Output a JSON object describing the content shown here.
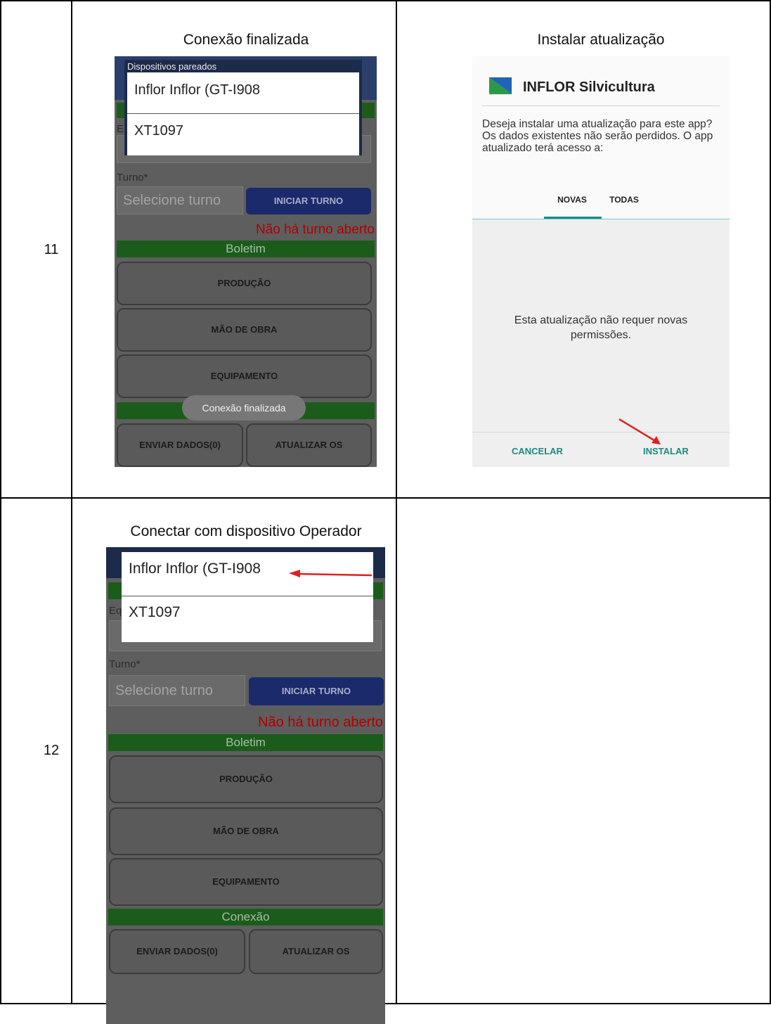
{
  "rows": [
    {
      "number": "11"
    },
    {
      "number": "12"
    }
  ],
  "panel_11_left": {
    "caption": "Conexão finalizada",
    "popup_title": "Dispositivos pareados",
    "devices": [
      "Inflor Inflor (GT-I908",
      "XT1097"
    ],
    "turno_label": "Turno*",
    "turno_placeholder": "Selecione turno",
    "iniciar_turno": "INICIAR TURNO",
    "no_shift": "Não há turno aberto",
    "boletim": "Boletim",
    "producao": "PRODUÇÃO",
    "mao_de_obra": "MÃO DE OBRA",
    "equipamento": "EQUIPAMENTO",
    "toast": "Conexão finalizada",
    "enviar_dados": "ENVIAR DADOS(0)",
    "atualizar_os": "ATUALIZAR OS"
  },
  "panel_11_right": {
    "caption": "Instalar atualização",
    "app_name": "INFLOR Silvicultura",
    "question": "Deseja instalar uma atualização para este app? Os dados existentes não serão perdidos. O app atualizado terá acesso a:",
    "tab_novas": "NOVAS",
    "tab_todas": "TODAS",
    "no_permissions": "Esta atualização não requer novas permissões.",
    "cancelar": "CANCELAR",
    "instalar": "INSTALAR"
  },
  "panel_12_left": {
    "caption": "Conectar com dispositivo Operador",
    "devices": [
      "Inflor Inflor (GT-I908",
      "XT1097"
    ],
    "turno_label": "Turno*",
    "turno_placeholder": "Selecione turno",
    "iniciar_turno": "INICIAR TURNO",
    "no_shift": "Não há turno aberto",
    "boletim": "Boletim",
    "producao": "PRODUÇÃO",
    "mao_de_obra": "MÃO DE OBRA",
    "equipamento": "EQUIPAMENTO",
    "conexao": "Conexão",
    "enviar_dados": "ENVIAR DADOS(0)",
    "atualizar_os": "ATUALIZAR OS"
  },
  "colors": {
    "app_green": "#1b5c1b",
    "app_navy": "#1a2a6a",
    "error_red": "#b20000",
    "teal_accent": "#1a8c82",
    "arrow_red": "#e02020"
  },
  "icons": [
    "inflor-logo-icon",
    "arrow-pointer-icon"
  ]
}
